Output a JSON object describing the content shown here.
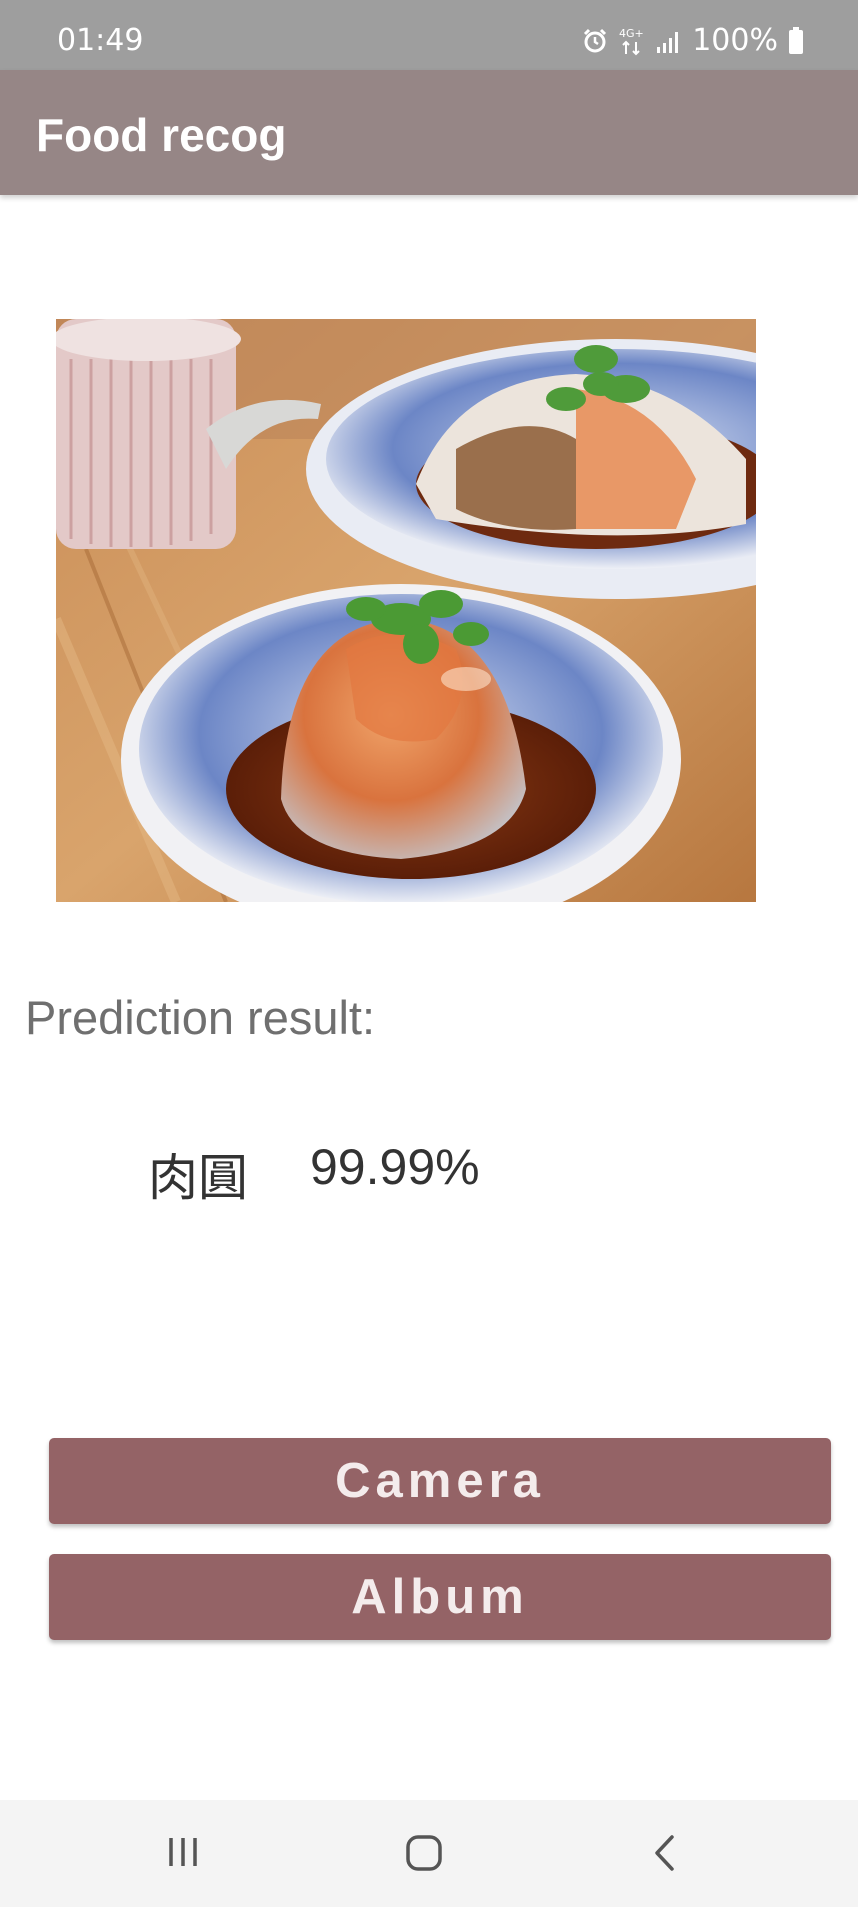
{
  "status_bar": {
    "time": "01:49",
    "network": "4G+",
    "battery": "100%",
    "icons": [
      "alarm-icon",
      "network-4g-icon",
      "signal-icon",
      "battery-icon"
    ]
  },
  "app_bar": {
    "title": "Food recog",
    "color": "#968686"
  },
  "image": {
    "subject": "food-photo"
  },
  "prediction": {
    "label": "Prediction result:",
    "food_name": "肉圓",
    "confidence": "99.99%"
  },
  "buttons": {
    "camera_label": "Camera",
    "album_label": "Album",
    "color": "#946366"
  },
  "nav_bar": {
    "icons": [
      "recent-apps-icon",
      "home-icon",
      "back-icon"
    ]
  }
}
